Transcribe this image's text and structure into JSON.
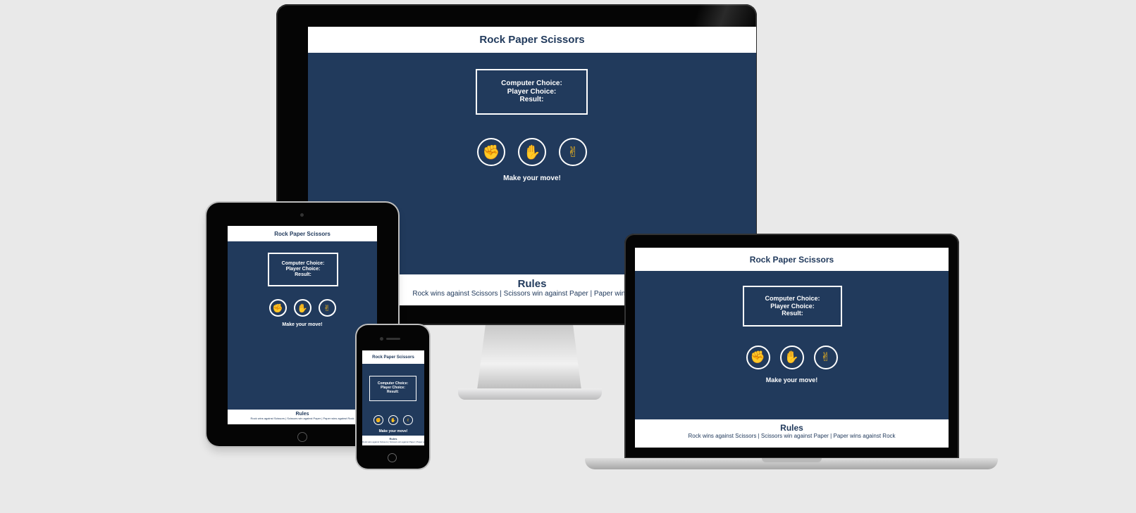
{
  "app": {
    "title": "Rock Paper Scissors",
    "score": {
      "computer_label": "Computer Choice:",
      "player_label": "Player Choice:",
      "result_label": "Result:"
    },
    "choices": [
      {
        "name": "rock",
        "icon": "raised-fist-icon",
        "glyph": "✊"
      },
      {
        "name": "paper",
        "icon": "raised-hand-icon",
        "glyph": "✋"
      },
      {
        "name": "scissors",
        "icon": "victory-hand-icon",
        "glyph": "✌"
      }
    ],
    "prompt": "Make your move!",
    "rules_title": "Rules",
    "rules_text": "Rock wins against Scissors | Scissors win against Paper | Paper wins against Rock",
    "rules_text_desktop_visible": "Rock wins against Scissors | Scissors win against Paper | Paper wins agains"
  },
  "colors": {
    "background": "#213a5c",
    "header": "#ffffff",
    "icon_yellow": "#f6b81c",
    "page": "#e9e9e9"
  }
}
